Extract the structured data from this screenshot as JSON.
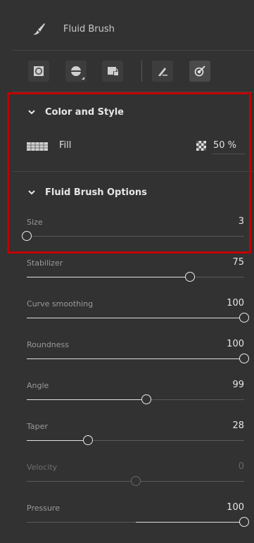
{
  "panel": {
    "title": "Fluid Brush",
    "brush_icon": "brush-icon"
  },
  "toolbar": {
    "tools": [
      {
        "icon": "shape-mask-icon",
        "active": false
      },
      {
        "icon": "layer-blend-icon",
        "active": false
      },
      {
        "icon": "lock-transparency-icon",
        "active": false
      },
      {
        "icon": "pen-pressure-icon",
        "active": false
      },
      {
        "icon": "brush-settings-icon",
        "active": true
      }
    ]
  },
  "color_style": {
    "title": "Color and Style",
    "fill_label": "Fill",
    "opacity_value": "50 %"
  },
  "fluid_options": {
    "title": "Fluid Brush Options",
    "sliders": [
      {
        "label": "Size",
        "value": "3",
        "fraction": 0.0,
        "disabled": false
      },
      {
        "label": "Stabilizer",
        "value": "75",
        "fraction": 0.75,
        "disabled": false
      },
      {
        "label": "Curve smoothing",
        "value": "100",
        "fraction": 1.0,
        "disabled": false
      },
      {
        "label": "Roundness",
        "value": "100",
        "fraction": 1.0,
        "disabled": false
      },
      {
        "label": "Angle",
        "value": "99",
        "fraction": 0.55,
        "disabled": false
      },
      {
        "label": "Taper",
        "value": "28",
        "fraction": 0.28,
        "disabled": false
      },
      {
        "label": "Velocity",
        "value": "0",
        "fraction": 0.5,
        "disabled": true
      },
      {
        "label": "Pressure",
        "value": "100",
        "fraction": 1.0,
        "from": 0.5,
        "disabled": false
      }
    ]
  },
  "colors": {
    "highlight": "#c20000",
    "panel_bg": "#323232"
  }
}
